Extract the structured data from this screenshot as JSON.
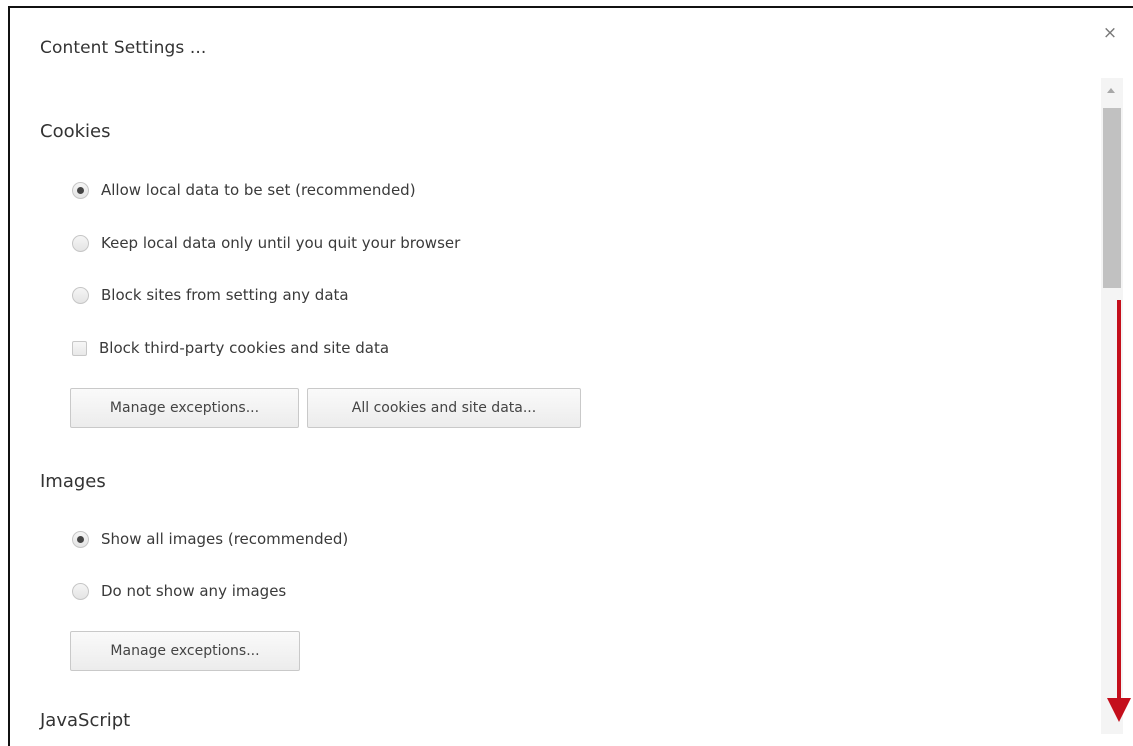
{
  "dialog": {
    "title": "Content Settings ...",
    "close_label": "×"
  },
  "cookies": {
    "heading": "Cookies",
    "options": [
      {
        "label": "Allow local data to be set (recommended)",
        "type": "radio",
        "checked": true
      },
      {
        "label": "Keep local data only until you quit your browser",
        "type": "radio",
        "checked": false
      },
      {
        "label": "Block sites from setting any data",
        "type": "radio",
        "checked": false
      },
      {
        "label": "Block third-party cookies and site data",
        "type": "checkbox",
        "checked": false
      }
    ],
    "buttons": {
      "manage_exceptions": "Manage exceptions...",
      "all_cookies": "All cookies and site data..."
    }
  },
  "images": {
    "heading": "Images",
    "options": [
      {
        "label": "Show all images (recommended)",
        "type": "radio",
        "checked": true
      },
      {
        "label": "Do not show any images",
        "type": "radio",
        "checked": false
      }
    ],
    "buttons": {
      "manage_exceptions": "Manage exceptions..."
    }
  },
  "javascript": {
    "heading": "JavaScript"
  },
  "annotation": {
    "arrow_color": "#c40f1c",
    "arrow_direction": "down"
  }
}
